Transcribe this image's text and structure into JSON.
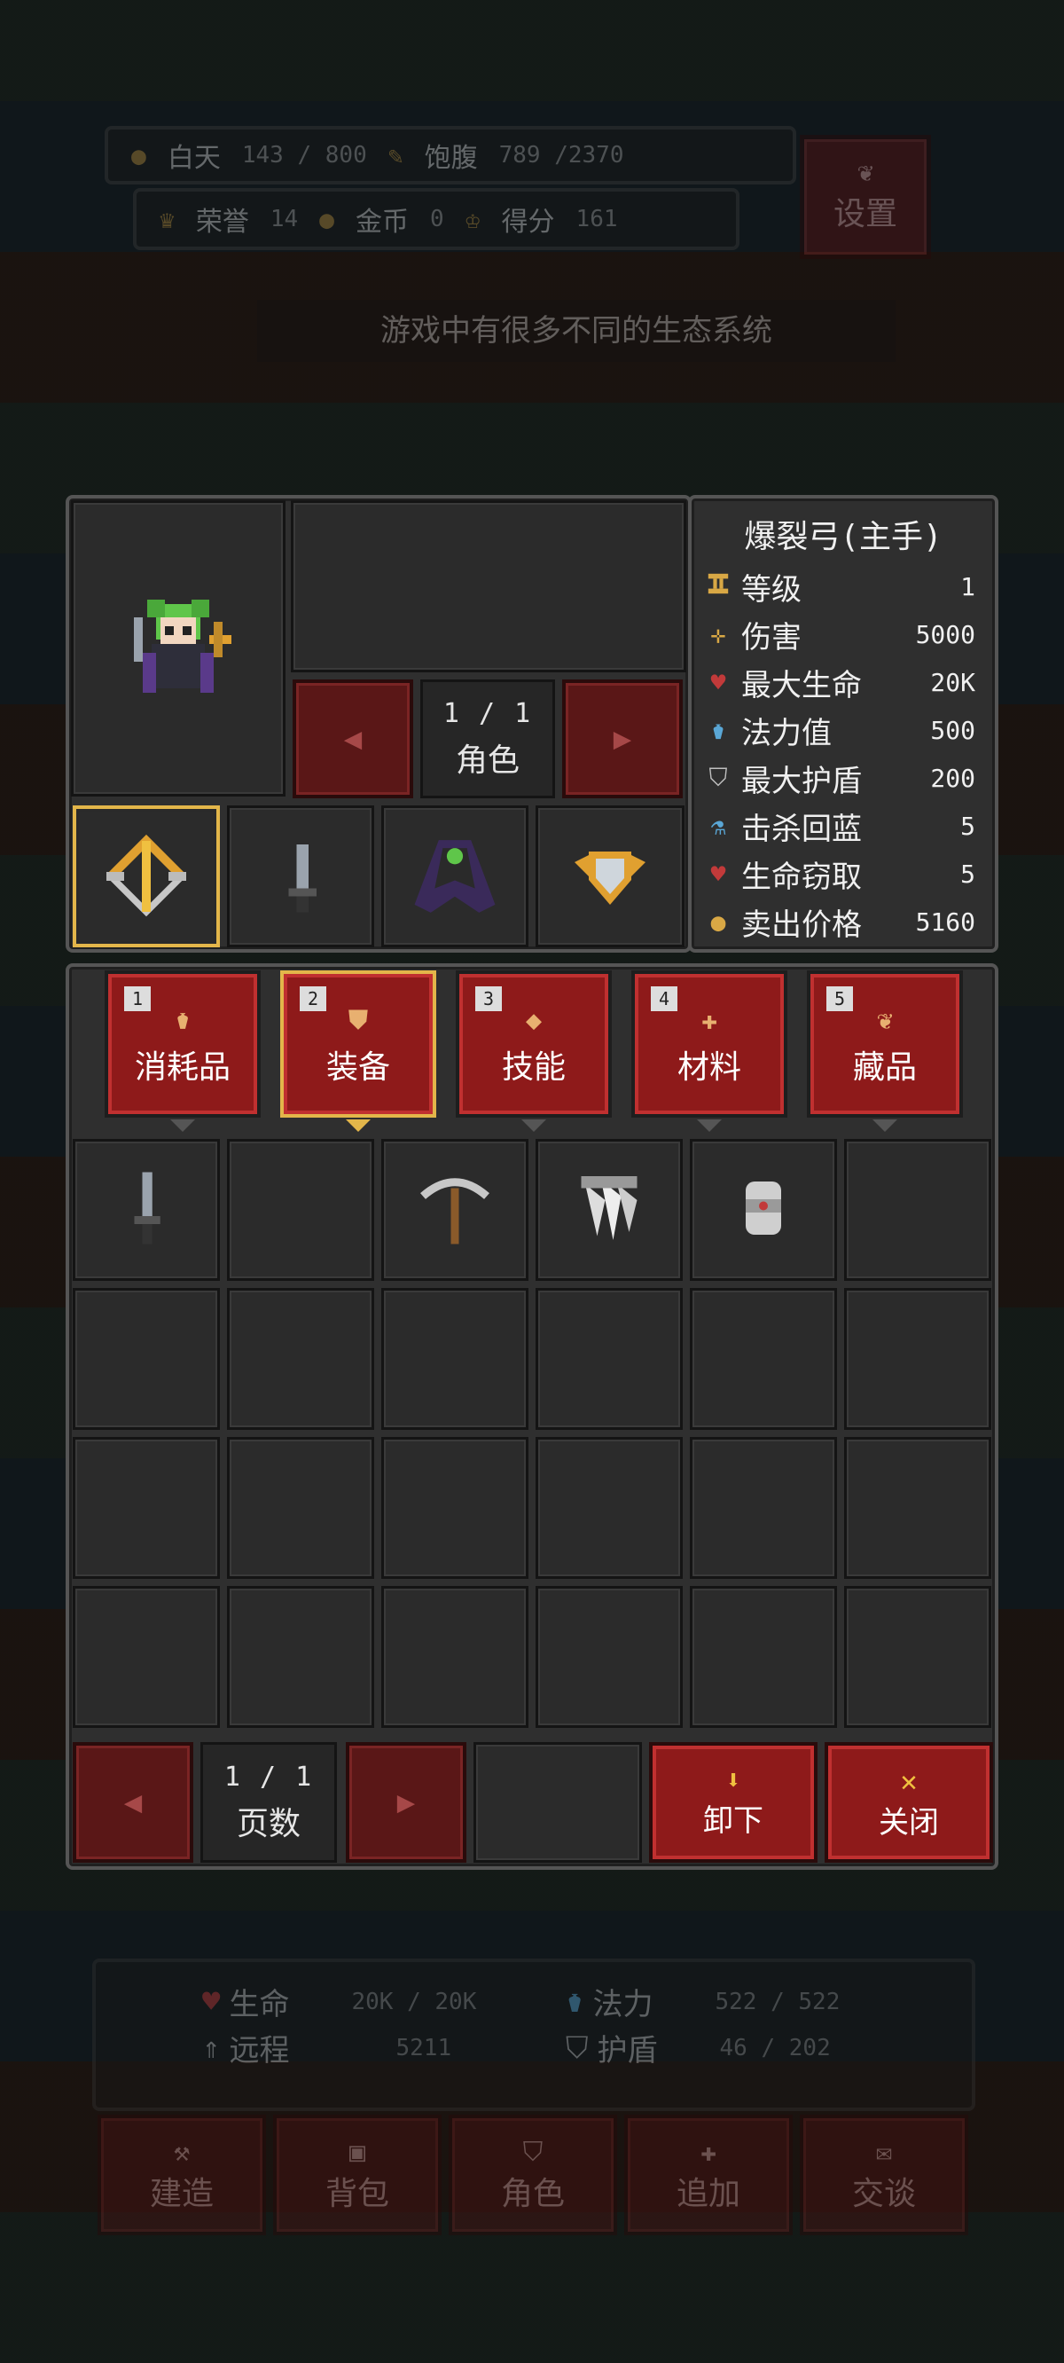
{
  "hud": {
    "time_label": "白天",
    "time_value": "143 / 800",
    "hunger_label": "饱腹",
    "hunger_value": "789 /2370",
    "honor_label": "荣誉",
    "honor_value": "14",
    "gold_label": "金币",
    "gold_value": "0",
    "score_label": "得分",
    "score_value": "161",
    "settings_label": "设置"
  },
  "toast": "游戏中有很多不同的生态系统",
  "character": {
    "pager_value": "1 / 1",
    "pager_label": "角色"
  },
  "equip_slots": [
    "bow-icon",
    "dagger-icon",
    "cloak-icon",
    "shield-icon"
  ],
  "item_stats": {
    "title": "爆裂弓(主手)",
    "rows": [
      {
        "icon": "level-icon",
        "label": "等级",
        "value": "1",
        "color": "#d9a845"
      },
      {
        "icon": "damage-icon",
        "label": "伤害",
        "value": "5000",
        "color": "#d9a845"
      },
      {
        "icon": "heart-icon",
        "label": "最大生命",
        "value": "20K",
        "color": "#c23a3a"
      },
      {
        "icon": "mana-flask-icon",
        "label": "法力值",
        "value": "500",
        "color": "#5aa7d6"
      },
      {
        "icon": "shield-small-icon",
        "label": "最大护盾",
        "value": "200",
        "color": "#bfbfbf"
      },
      {
        "icon": "mana-regen-icon",
        "label": "击杀回蓝",
        "value": "5",
        "color": "#5aa7d6"
      },
      {
        "icon": "lifesteal-icon",
        "label": "生命窃取",
        "value": "5",
        "color": "#c23a3a"
      },
      {
        "icon": "coin-icon",
        "label": "卖出价格",
        "value": "5160",
        "color": "#d9a845"
      }
    ]
  },
  "tabs": [
    {
      "num": "1",
      "label": "消耗品",
      "icon": "potion-icon"
    },
    {
      "num": "2",
      "label": "装备",
      "icon": "armor-icon"
    },
    {
      "num": "3",
      "label": "技能",
      "icon": "skill-gem-icon"
    },
    {
      "num": "4",
      "label": "材料",
      "icon": "material-icon"
    },
    {
      "num": "5",
      "label": "藏品",
      "icon": "leaf-icon"
    }
  ],
  "inventory_items": [
    "dagger-icon",
    "",
    "pickaxe-icon",
    "claw-icon",
    "canister-icon"
  ],
  "inventory_pager": {
    "value": "1 / 1",
    "label": "页数"
  },
  "actions": {
    "unequip": "卸下",
    "close": "关闭"
  },
  "bottom_hud": {
    "hp_label": "生命",
    "hp_value": "20K / 20K",
    "mana_label": "法力",
    "mana_value": "522 / 522",
    "range_label": "远程",
    "range_value": "5211",
    "shield_label": "护盾",
    "shield_value": "46 / 202"
  },
  "nav": [
    "建造",
    "背包",
    "角色",
    "追加",
    "交谈"
  ],
  "colors": {
    "accent": "#e3b64a",
    "button_red": "#8e1a1a"
  }
}
